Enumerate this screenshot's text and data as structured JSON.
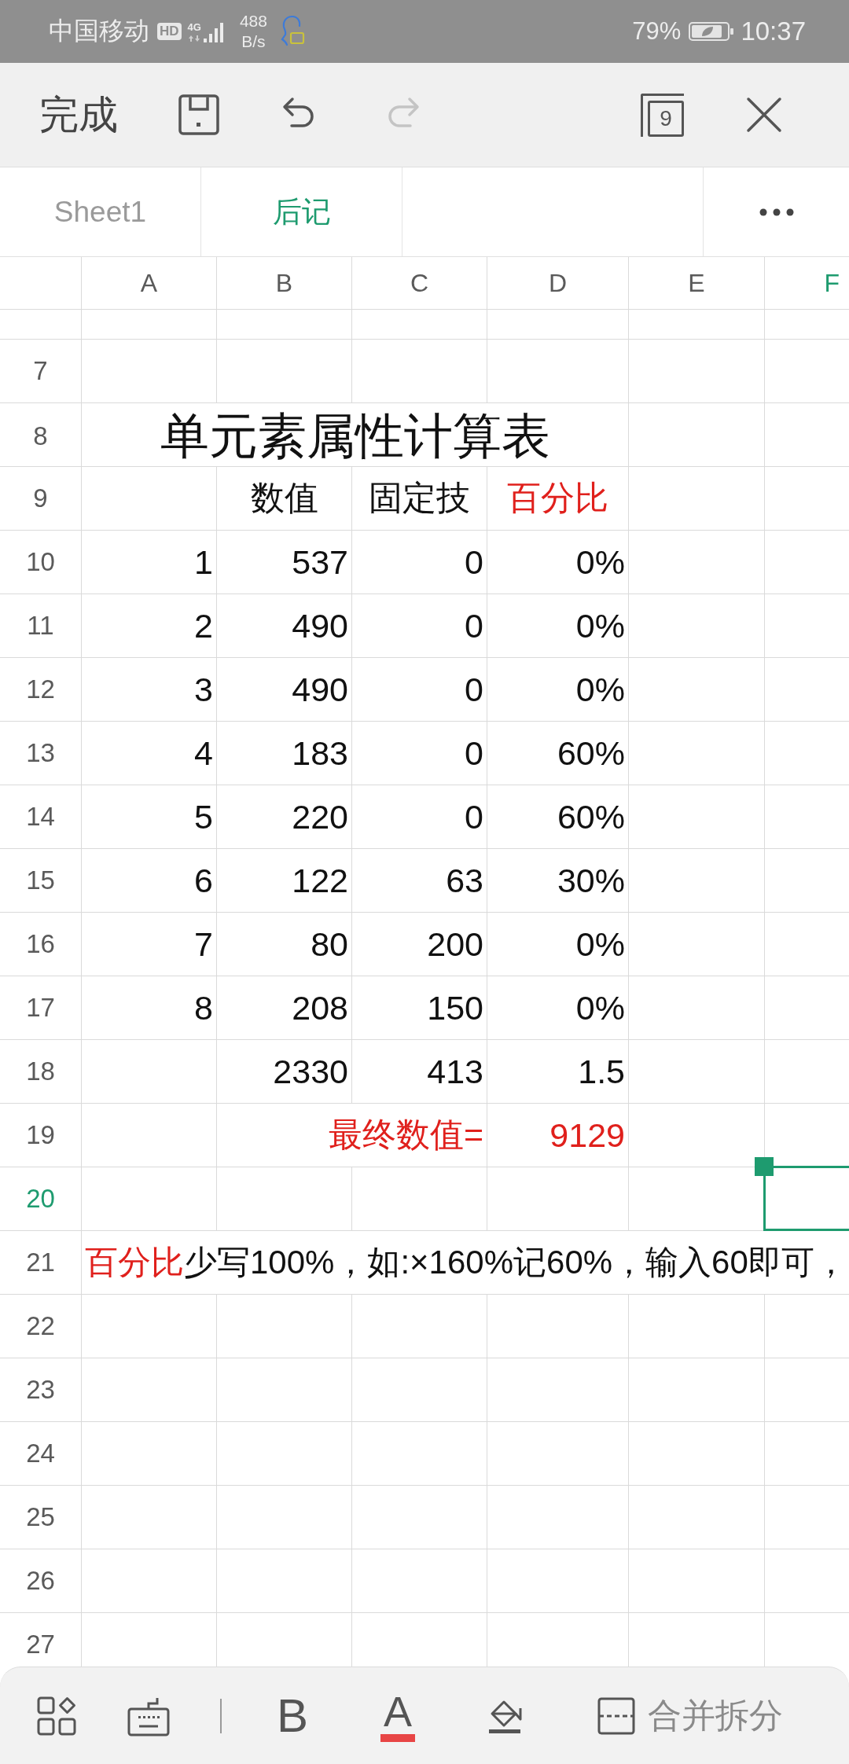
{
  "status_bar": {
    "carrier": "中国移动",
    "hd_badge": "HD",
    "network": "4G",
    "speed_value": "488",
    "speed_unit": "B/s",
    "battery": "79%",
    "time": "10:37"
  },
  "toolbar": {
    "done": "完成",
    "redo_disabled": true,
    "window_count": "9"
  },
  "sheet_tabs": [
    {
      "label": "Sheet1",
      "selected": false
    },
    {
      "label": "后记",
      "selected": true
    }
  ],
  "grid": {
    "columns": [
      {
        "label": "A",
        "selected": false
      },
      {
        "label": "B",
        "selected": false
      },
      {
        "label": "C",
        "selected": false
      },
      {
        "label": "D",
        "selected": false
      },
      {
        "label": "E",
        "selected": false
      },
      {
        "label": "F",
        "selected": true
      }
    ],
    "rows": [
      {
        "number": "7",
        "selected": false,
        "kind": "empty"
      },
      {
        "number": "8",
        "selected": false,
        "kind": "title",
        "title": "单元素属性计算表"
      },
      {
        "number": "9",
        "selected": false,
        "kind": "header",
        "cells": [
          {},
          {
            "text": "数值",
            "highlight": false
          },
          {
            "text": "固定技",
            "highlight": false
          },
          {
            "text": "百分比",
            "highlight": true
          }
        ]
      },
      {
        "number": "10",
        "selected": false,
        "kind": "data",
        "cells": [
          {
            "text": "1",
            "highlight": false
          },
          {
            "text": "537",
            "highlight": false
          },
          {
            "text": "0",
            "highlight": false
          },
          {
            "text": "0%",
            "highlight": false
          }
        ]
      },
      {
        "number": "11",
        "selected": false,
        "kind": "data",
        "cells": [
          {
            "text": "2",
            "highlight": false
          },
          {
            "text": "490",
            "highlight": false
          },
          {
            "text": "0",
            "highlight": false
          },
          {
            "text": "0%",
            "highlight": false
          }
        ]
      },
      {
        "number": "12",
        "selected": false,
        "kind": "data",
        "cells": [
          {
            "text": "3",
            "highlight": false
          },
          {
            "text": "490",
            "highlight": false
          },
          {
            "text": "0",
            "highlight": false
          },
          {
            "text": "0%",
            "highlight": false
          }
        ]
      },
      {
        "number": "13",
        "selected": false,
        "kind": "data",
        "cells": [
          {
            "text": "4",
            "highlight": false
          },
          {
            "text": "183",
            "highlight": false
          },
          {
            "text": "0",
            "highlight": false
          },
          {
            "text": "60%",
            "highlight": false
          }
        ]
      },
      {
        "number": "14",
        "selected": false,
        "kind": "data",
        "cells": [
          {
            "text": "5",
            "highlight": false
          },
          {
            "text": "220",
            "highlight": false
          },
          {
            "text": "0",
            "highlight": false
          },
          {
            "text": "60%",
            "highlight": false
          }
        ]
      },
      {
        "number": "15",
        "selected": false,
        "kind": "data",
        "cells": [
          {
            "text": "6",
            "highlight": false
          },
          {
            "text": "122",
            "highlight": false
          },
          {
            "text": "63",
            "highlight": false
          },
          {
            "text": "30%",
            "highlight": false
          }
        ]
      },
      {
        "number": "16",
        "selected": false,
        "kind": "data",
        "cells": [
          {
            "text": "7",
            "highlight": false
          },
          {
            "text": "80",
            "highlight": false
          },
          {
            "text": "200",
            "highlight": false
          },
          {
            "text": "0%",
            "highlight": false
          }
        ]
      },
      {
        "number": "17",
        "selected": false,
        "kind": "data",
        "cells": [
          {
            "text": "8",
            "highlight": false
          },
          {
            "text": "208",
            "highlight": false
          },
          {
            "text": "150",
            "highlight": false
          },
          {
            "text": "0%",
            "highlight": false
          }
        ]
      },
      {
        "number": "18",
        "selected": false,
        "kind": "data",
        "cells": [
          {},
          {
            "text": "2330",
            "highlight": false
          },
          {
            "text": "413",
            "highlight": false
          },
          {
            "text": "1.5",
            "highlight": false
          }
        ]
      },
      {
        "number": "19",
        "selected": false,
        "kind": "total",
        "cells": [
          {},
          {},
          {
            "text": "最终数值=",
            "highlight": true
          },
          {
            "text": "9129",
            "highlight": true
          }
        ]
      },
      {
        "number": "20",
        "selected": true,
        "kind": "empty"
      },
      {
        "number": "21",
        "selected": false,
        "kind": "note",
        "runs": [
          {
            "text": "百分比",
            "highlight": true
          },
          {
            "text": "少写100%，如:×160%记60%，输入60即可，",
            "highlight": false
          }
        ]
      },
      {
        "number": "22",
        "selected": false,
        "kind": "empty"
      },
      {
        "number": "23",
        "selected": false,
        "kind": "empty"
      },
      {
        "number": "24",
        "selected": false,
        "kind": "empty"
      },
      {
        "number": "25",
        "selected": false,
        "kind": "empty"
      },
      {
        "number": "26",
        "selected": false,
        "kind": "empty"
      },
      {
        "number": "27",
        "selected": false,
        "kind": "empty"
      }
    ]
  },
  "bottom_toolbar": {
    "bold": "B",
    "font_color": "A",
    "merge": "合并拆分"
  }
}
